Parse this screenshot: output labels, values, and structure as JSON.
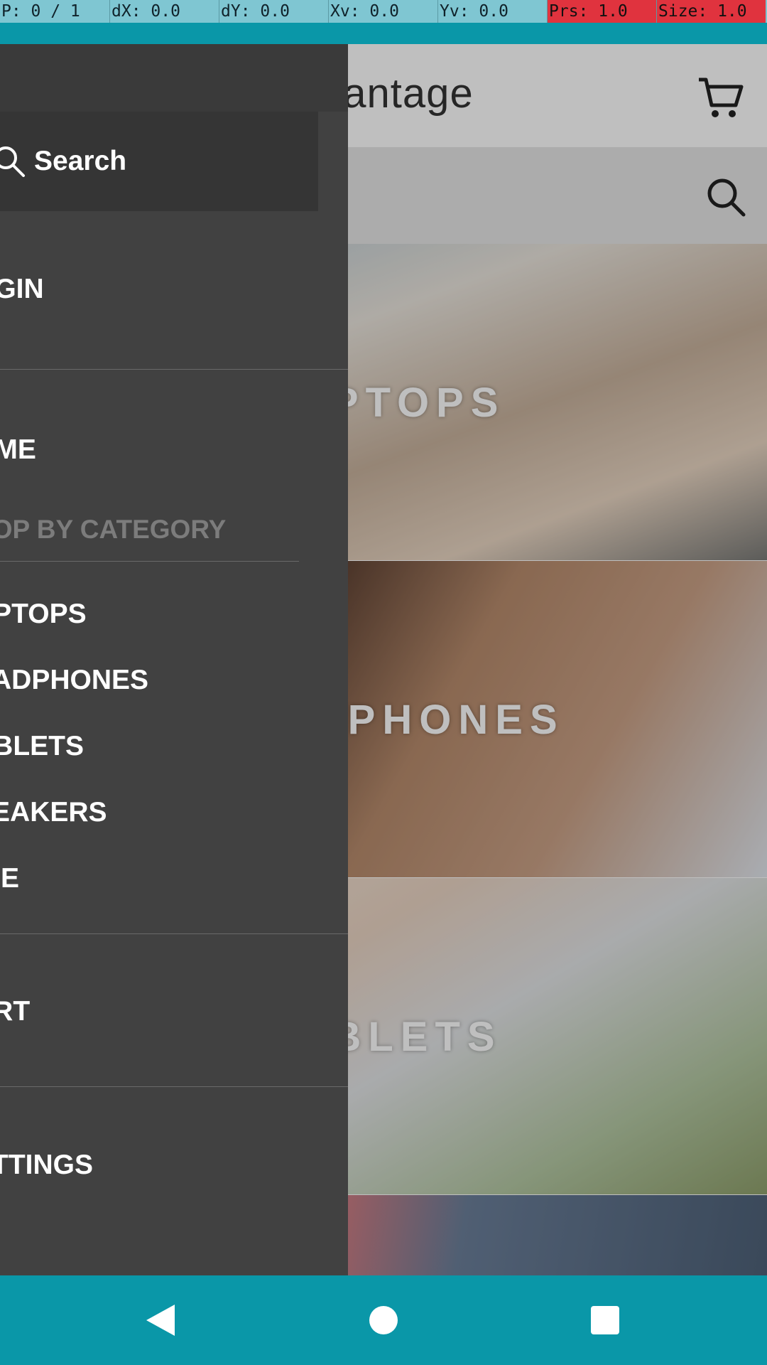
{
  "debug": {
    "pointer": "P: 0 / 1",
    "dx": "dX: 0.0",
    "dy": "dY: 0.0",
    "xv": "Xv: 0.0",
    "yv": "Yv: 0.0",
    "prs": "Prs: 1.0",
    "size": "Size: 1.0"
  },
  "app": {
    "title_visible": "vantage",
    "tiles": [
      {
        "label": "LAPTOPS"
      },
      {
        "label": "HEADPHONES"
      },
      {
        "label": "TABLETS"
      },
      {
        "label": ""
      }
    ]
  },
  "drawer": {
    "search_label": "Search",
    "login": "OGIN",
    "home": "OME",
    "section_head": "HOP BY CATEGORY",
    "categories": [
      "APTOPS",
      "EADPHONES",
      "ABLETS",
      "PEAKERS",
      "ICE"
    ],
    "cart": "ART",
    "settings": "ETTINGS"
  },
  "colors": {
    "drawer_bg": "#414141",
    "accent": "#0a97a8",
    "debug_alert": "#e0333e"
  },
  "icons": {
    "search": "search-icon",
    "cart": "cart-icon",
    "back": "back-icon",
    "home": "home-icon",
    "recents": "recents-icon"
  }
}
